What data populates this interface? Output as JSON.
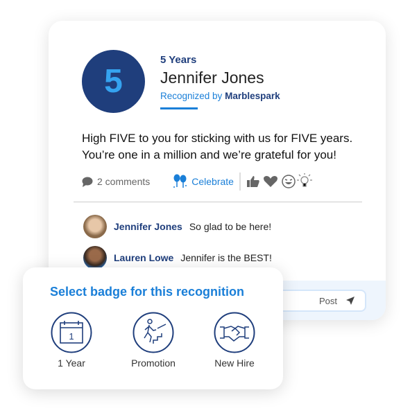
{
  "recognition": {
    "badge_number": "5",
    "years": "5 Years",
    "name": "Jennifer Jones",
    "recognized_by_prefix": "Recognized by",
    "recognized_by": "Marblespark",
    "message": "High FIVE to you for sticking with us for FIVE years. You’re one in a million and we’re grateful for you!"
  },
  "actions": {
    "comments": "2 comments",
    "celebrate": "Celebrate",
    "reactions": [
      "thumbs-up-icon",
      "heart-icon",
      "laugh-icon",
      "lightbulb-icon"
    ]
  },
  "comments": [
    {
      "author": "Jennifer Jones",
      "text": "So glad to be here!"
    },
    {
      "author": "Lauren Lowe",
      "text": "Jennifer is the BEST!"
    }
  ],
  "post": {
    "label": "Post"
  },
  "badge_picker": {
    "title": "Select badge for this recognition",
    "badges": [
      {
        "label": "1 Year",
        "icon": "calendar-icon",
        "day": "1"
      },
      {
        "label": "Promotion",
        "icon": "stairs-climb-icon"
      },
      {
        "label": "New Hire",
        "icon": "handshake-icon"
      }
    ]
  },
  "colors": {
    "navy": "#1f3e7c",
    "blue": "#1a7fd8"
  }
}
